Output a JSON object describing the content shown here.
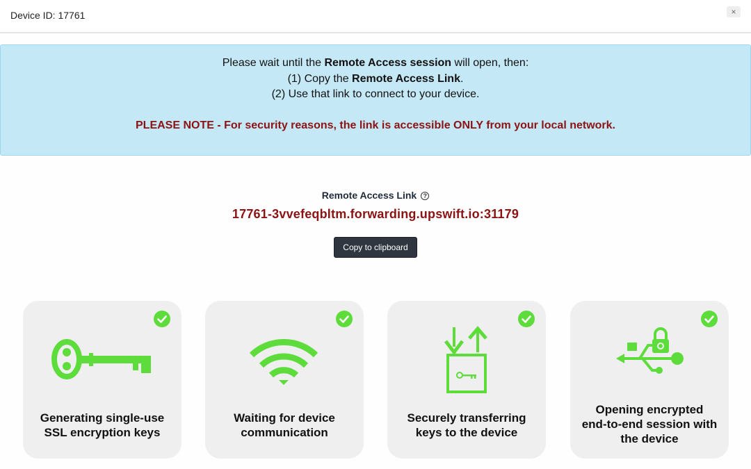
{
  "header": {
    "title": "Device ID: 17761",
    "close_label": "×"
  },
  "alert": {
    "line1_pre": "Please wait until the ",
    "line1_bold": "Remote Access session",
    "line1_post": " will open, then:",
    "line2_pre": "(1) Copy the ",
    "line2_bold": "Remote Access Link",
    "line2_post": ".",
    "line3": "(2) Use that link to connect to your device.",
    "note": "PLEASE NOTE - For security reasons, the link is accessible ONLY from your local network."
  },
  "remote_link": {
    "label": "Remote Access Link",
    "help_icon": "?",
    "value": "17761-3vvefeqbltm.forwarding.upswift.io:31179",
    "copy_label": "Copy to clipboard"
  },
  "steps": [
    {
      "icon": "key-icon",
      "caption_line1": "Generating single-use",
      "caption_line2": "SSL encryption keys",
      "caption_line3": "",
      "status": "complete"
    },
    {
      "icon": "wifi-icon",
      "caption_line1": "Waiting for device",
      "caption_line2": "communication",
      "caption_line3": "",
      "status": "complete"
    },
    {
      "icon": "transfer-icon",
      "caption_line1": "Securely transferring",
      "caption_line2": "keys to the device",
      "caption_line3": "",
      "status": "complete"
    },
    {
      "icon": "usb-lock-icon",
      "caption_line1": "Opening encrypted",
      "caption_line2": "end-to-end session with",
      "caption_line3": "the device",
      "status": "complete"
    }
  ],
  "colors": {
    "accent_green": "#5ddc3c",
    "note_red": "#8b1313",
    "alert_bg": "#c5e8f6",
    "button_dark": "#2f3640"
  }
}
